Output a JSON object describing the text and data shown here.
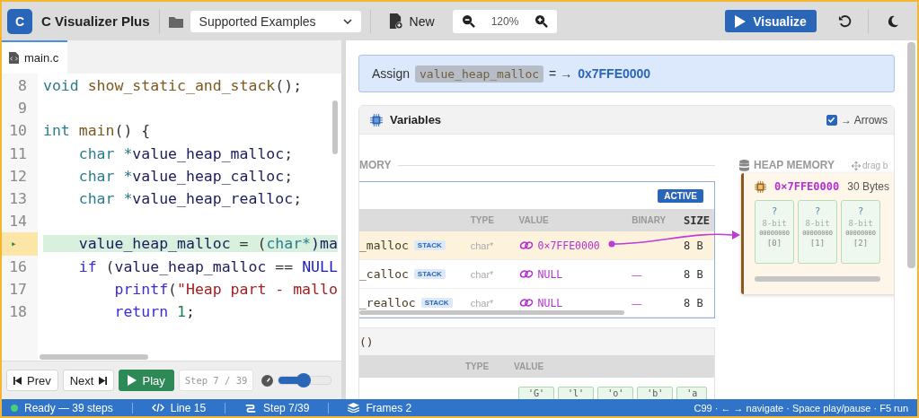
{
  "app": {
    "logo": "C",
    "title": "C Visualizer Plus"
  },
  "toolbar": {
    "example_select": "Supported Examples",
    "new_button": "New",
    "zoom": "120%",
    "visualize_button": "Visualize"
  },
  "editor": {
    "tab": {
      "label": "main.c",
      "selected": true
    },
    "lines": [
      {
        "number": "8",
        "current": false,
        "tokens": [
          {
            "kind": "kw",
            "text": "void "
          },
          {
            "kind": "fn",
            "text": "show_static_and_stack"
          },
          {
            "kind": "punct",
            "text": "();"
          }
        ]
      },
      {
        "number": "9",
        "current": false
      },
      {
        "number": "10",
        "current": false,
        "tokens": [
          {
            "kind": "kw",
            "text": "int "
          },
          {
            "kind": "fn",
            "text": "main"
          },
          {
            "kind": "punct",
            "text": "() {"
          }
        ]
      },
      {
        "number": "11",
        "current": false,
        "tokens": [
          {
            "kind": "kw",
            "text": "    char *"
          },
          {
            "kind": "id",
            "text": "value_heap_malloc"
          },
          {
            "kind": "punct",
            "text": ";"
          }
        ]
      },
      {
        "number": "12",
        "current": false,
        "tokens": [
          {
            "kind": "kw",
            "text": "    char *"
          },
          {
            "kind": "id",
            "text": "value_heap_calloc"
          },
          {
            "kind": "punct",
            "text": ";"
          }
        ]
      },
      {
        "number": "13",
        "current": false,
        "tokens": [
          {
            "kind": "kw",
            "text": "    char *"
          },
          {
            "kind": "id",
            "text": "value_heap_realloc"
          },
          {
            "kind": "punct",
            "text": ";"
          }
        ]
      },
      {
        "number": "14",
        "current": false
      },
      {
        "number": "▸",
        "current": true,
        "tokens": [
          {
            "kind": "id",
            "text": "    value_heap_malloc"
          },
          {
            "kind": "punct",
            "text": " = ("
          },
          {
            "kind": "kw",
            "text": "char*"
          },
          {
            "kind": "id",
            "text": ")ma"
          }
        ]
      },
      {
        "number": "16",
        "current": false,
        "tokens": [
          {
            "kind": "ctrl",
            "text": "    if"
          },
          {
            "kind": "punct",
            "text": " ("
          },
          {
            "kind": "id",
            "text": "value_heap_malloc"
          },
          {
            "kind": "punct",
            "text": " == "
          },
          {
            "kind": "const",
            "text": "NULL"
          }
        ]
      },
      {
        "number": "17",
        "current": false,
        "tokens": [
          {
            "kind": "ctrl",
            "text": "        printf"
          },
          {
            "kind": "punct",
            "text": "("
          },
          {
            "kind": "str",
            "text": "\"Heap part - mallo"
          }
        ]
      },
      {
        "number": "18",
        "current": false,
        "tokens": [
          {
            "kind": "ctrl",
            "text": "        return "
          },
          {
            "kind": "num",
            "text": "1"
          },
          {
            "kind": "punct",
            "text": ";"
          }
        ]
      }
    ]
  },
  "controls": {
    "prev": "Prev",
    "next": "Next",
    "play": "Play",
    "step": "Step 7 / 39",
    "speed": {
      "level": 0.47
    }
  },
  "banner": {
    "prefix": "Assign",
    "variable": "value_heap_malloc",
    "operator": "= →",
    "value": "0x7FFE0000"
  },
  "variables": {
    "title": "Variables",
    "arrows": {
      "label": "→ Arrows",
      "checked": true
    },
    "stack_label": "MORY",
    "active_frame": {
      "badge": "ACTIVE",
      "columns": [
        "TYPE",
        "VALUE",
        "BINARY",
        "SIZE"
      ],
      "rows": [
        {
          "name": "_malloc",
          "storage": "STACK",
          "type": "char*",
          "value": "0×7FFE0000",
          "size": "8 B",
          "selected": true
        },
        {
          "name": "_calloc",
          "storage": "STACK",
          "type": "char*",
          "value": "NULL",
          "binary": "—",
          "size": "8 B",
          "selected": false
        },
        {
          "name": "_realloc",
          "storage": "STACK",
          "type": "char*",
          "value": "NULL",
          "binary": "—",
          "size": "8 B",
          "selected": false
        }
      ]
    },
    "second_frame": {
      "title": "()",
      "columns": [
        "TYPE",
        "VALUE"
      ],
      "chars": [
        "'G'",
        "'l'",
        "'o'",
        "'b'",
        "'a"
      ]
    },
    "heap": {
      "label": "HEAP MEMORY",
      "hint": "drag b",
      "address": "0×7FFE0000",
      "size": "30 Bytes",
      "cells": [
        {
          "value": "?",
          "bits": "8-bit",
          "binary": "00000000",
          "index": "[0]"
        },
        {
          "value": "?",
          "bits": "8-bit",
          "binary": "00000000",
          "index": "[1]"
        },
        {
          "value": "?",
          "bits": "8-bit",
          "binary": "00000000",
          "index": "[2]"
        }
      ]
    }
  },
  "status_bar": {
    "ready": "Ready — 39 steps",
    "line": "Line 15",
    "step": "Step 7/39",
    "frames": "Frames 2",
    "hints": "C99 · ← → navigate · Space play/pause · F5 run"
  }
}
